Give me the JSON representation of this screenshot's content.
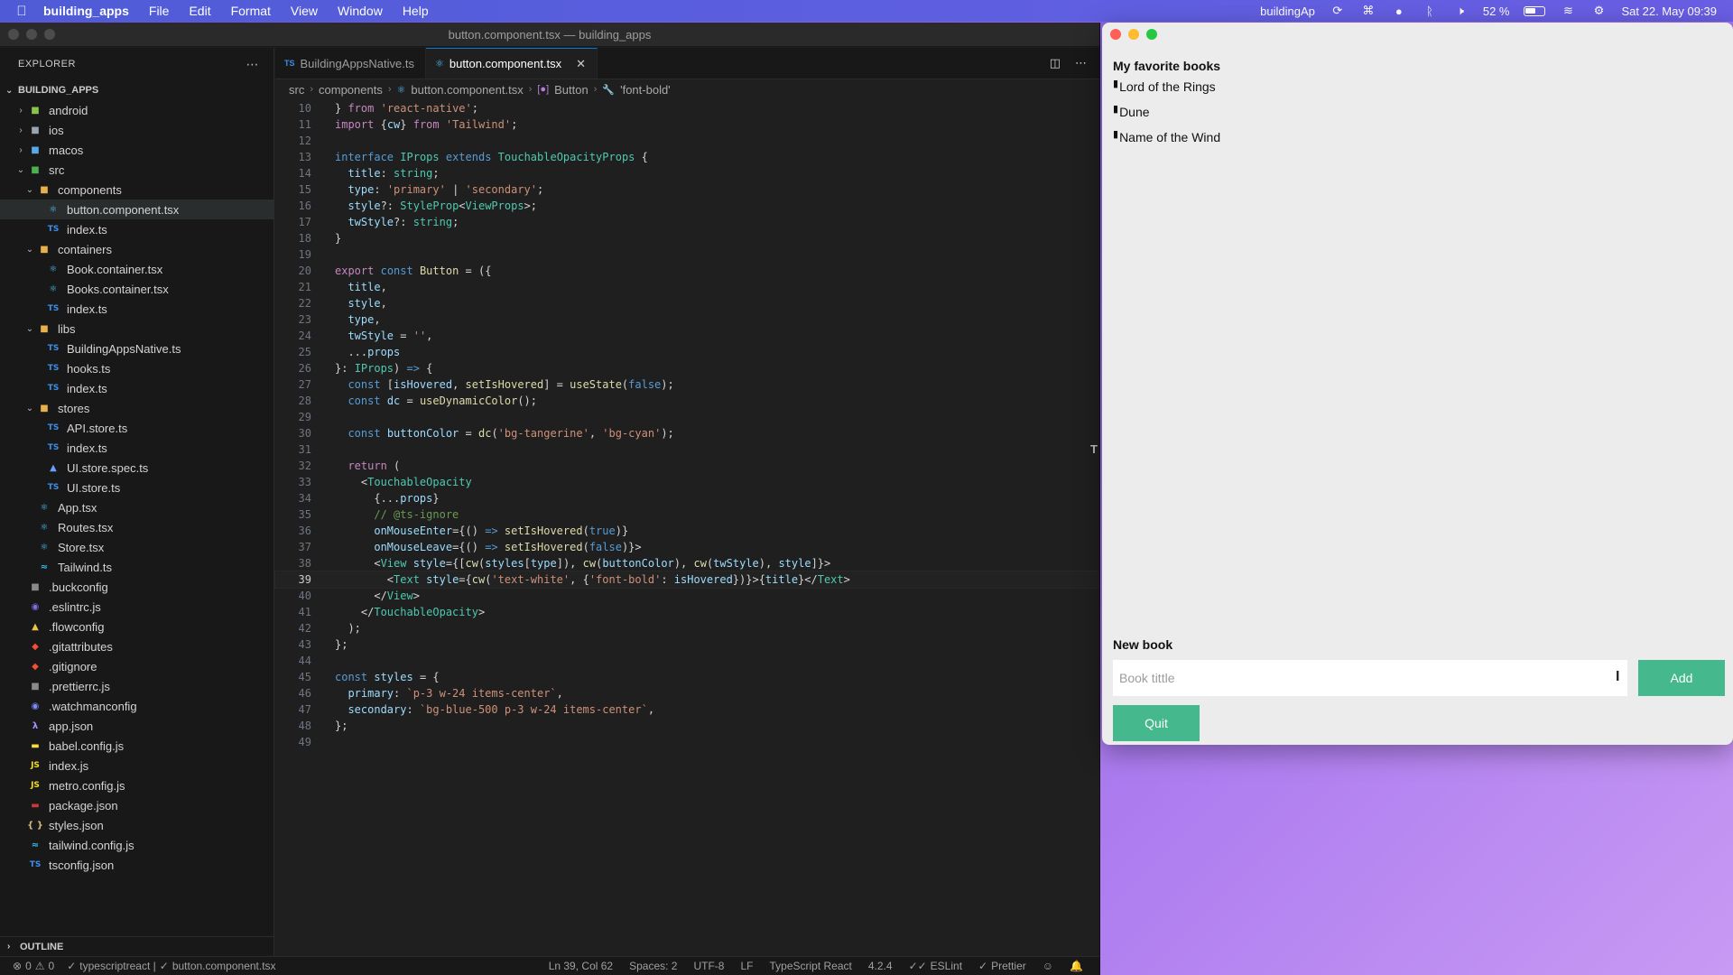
{
  "menubar": {
    "apple_icon": "apple-icon",
    "app_name": "building_apps",
    "menus": [
      "File",
      "Edit",
      "Format",
      "View",
      "Window",
      "Help"
    ],
    "tray_app": "buildingAp",
    "battery_percent": "52 %",
    "battery_level": 0.52,
    "datetime": "Sat 22. May  09:39"
  },
  "vscode": {
    "window_title": "button.component.tsx — building_apps",
    "explorer_label": "EXPLORER",
    "root_label": "BUILDING_APPS",
    "tree": [
      {
        "label": "android",
        "indent": 1,
        "chev": "›",
        "icon": "folder-android"
      },
      {
        "label": "ios",
        "indent": 1,
        "chev": "›",
        "icon": "folder-ios"
      },
      {
        "label": "macos",
        "indent": 1,
        "chev": "›",
        "icon": "folder-macos"
      },
      {
        "label": "src",
        "indent": 1,
        "chev": "⌄",
        "icon": "folder-src"
      },
      {
        "label": "components",
        "indent": 2,
        "chev": "⌄",
        "icon": "folder"
      },
      {
        "label": "button.component.tsx",
        "indent": 3,
        "chev": "",
        "icon": "react",
        "selected": true
      },
      {
        "label": "index.ts",
        "indent": 3,
        "chev": "",
        "icon": "ts"
      },
      {
        "label": "containers",
        "indent": 2,
        "chev": "⌄",
        "icon": "folder"
      },
      {
        "label": "Book.container.tsx",
        "indent": 3,
        "chev": "",
        "icon": "react"
      },
      {
        "label": "Books.container.tsx",
        "indent": 3,
        "chev": "",
        "icon": "react"
      },
      {
        "label": "index.ts",
        "indent": 3,
        "chev": "",
        "icon": "ts"
      },
      {
        "label": "libs",
        "indent": 2,
        "chev": "⌄",
        "icon": "folder"
      },
      {
        "label": "BuildingAppsNative.ts",
        "indent": 3,
        "chev": "",
        "icon": "ts"
      },
      {
        "label": "hooks.ts",
        "indent": 3,
        "chev": "",
        "icon": "ts"
      },
      {
        "label": "index.ts",
        "indent": 3,
        "chev": "",
        "icon": "ts"
      },
      {
        "label": "stores",
        "indent": 2,
        "chev": "⌄",
        "icon": "folder"
      },
      {
        "label": "API.store.ts",
        "indent": 3,
        "chev": "",
        "icon": "ts"
      },
      {
        "label": "index.ts",
        "indent": 3,
        "chev": "",
        "icon": "ts"
      },
      {
        "label": "UI.store.spec.ts",
        "indent": 3,
        "chev": "",
        "icon": "test"
      },
      {
        "label": "UI.store.ts",
        "indent": 3,
        "chev": "",
        "icon": "ts"
      },
      {
        "label": "App.tsx",
        "indent": 2,
        "chev": "",
        "icon": "react"
      },
      {
        "label": "Routes.tsx",
        "indent": 2,
        "chev": "",
        "icon": "react"
      },
      {
        "label": "Store.tsx",
        "indent": 2,
        "chev": "",
        "icon": "react"
      },
      {
        "label": "Tailwind.ts",
        "indent": 2,
        "chev": "",
        "icon": "tw"
      },
      {
        "label": ".buckconfig",
        "indent": 1,
        "chev": "",
        "icon": "misc"
      },
      {
        "label": ".eslintrc.js",
        "indent": 1,
        "chev": "",
        "icon": "eslint"
      },
      {
        "label": ".flowconfig",
        "indent": 1,
        "chev": "",
        "icon": "flow"
      },
      {
        "label": ".gitattributes",
        "indent": 1,
        "chev": "",
        "icon": "git"
      },
      {
        "label": ".gitignore",
        "indent": 1,
        "chev": "",
        "icon": "git"
      },
      {
        "label": ".prettierrc.js",
        "indent": 1,
        "chev": "",
        "icon": "misc"
      },
      {
        "label": ".watchmanconfig",
        "indent": 1,
        "chev": "",
        "icon": "watch"
      },
      {
        "label": "app.json",
        "indent": 1,
        "chev": "",
        "icon": "app"
      },
      {
        "label": "babel.config.js",
        "indent": 1,
        "chev": "",
        "icon": "babel"
      },
      {
        "label": "index.js",
        "indent": 1,
        "chev": "",
        "icon": "js"
      },
      {
        "label": "metro.config.js",
        "indent": 1,
        "chev": "",
        "icon": "js"
      },
      {
        "label": "package.json",
        "indent": 1,
        "chev": "",
        "icon": "npm"
      },
      {
        "label": "styles.json",
        "indent": 1,
        "chev": "",
        "icon": "json"
      },
      {
        "label": "tailwind.config.js",
        "indent": 1,
        "chev": "",
        "icon": "tw"
      },
      {
        "label": "tsconfig.json",
        "indent": 1,
        "chev": "",
        "icon": "ts"
      }
    ],
    "outline_label": "OUTLINE",
    "tabs": [
      {
        "label": "BuildingAppsNative.ts",
        "active": false
      },
      {
        "label": "button.component.tsx",
        "active": true
      }
    ],
    "breadcrumb": [
      "src",
      "components",
      "button.component.tsx",
      "Button",
      "'font-bold'"
    ],
    "current_line": 39,
    "code": [
      {
        "n": "10",
        "html": "} <span class='kw2'>from</span> <span class='str'>'react-native'</span>;"
      },
      {
        "n": "11",
        "html": "<span class='kw2'>import</span> {<span class='var'>cw</span>} <span class='kw2'>from</span> <span class='str'>'Tailwind'</span>;"
      },
      {
        "n": "12",
        "html": ""
      },
      {
        "n": "13",
        "html": "<span class='kw'>interface</span> <span class='typ'>IProps</span> <span class='kw'>extends</span> <span class='typ'>TouchableOpacityProps</span> {"
      },
      {
        "n": "14",
        "html": "  <span class='var'>title</span>: <span class='typ'>string</span>;"
      },
      {
        "n": "15",
        "html": "  <span class='var'>type</span>: <span class='str'>'primary'</span> | <span class='str'>'secondary'</span>;"
      },
      {
        "n": "16",
        "html": "  <span class='var'>style</span>?: <span class='typ'>StyleProp</span>&lt;<span class='typ'>ViewProps</span>&gt;;"
      },
      {
        "n": "17",
        "html": "  <span class='var'>twStyle</span>?: <span class='typ'>string</span>;"
      },
      {
        "n": "18",
        "html": "}"
      },
      {
        "n": "19",
        "html": ""
      },
      {
        "n": "20",
        "html": "<span class='kw2'>export</span> <span class='kw'>const</span> <span class='fn'>Button</span> = ({"
      },
      {
        "n": "21",
        "html": "  <span class='var'>title</span>,"
      },
      {
        "n": "22",
        "html": "  <span class='var'>style</span>,"
      },
      {
        "n": "23",
        "html": "  <span class='var'>type</span>,"
      },
      {
        "n": "24",
        "html": "  <span class='var'>twStyle</span> = <span class='str'>''</span>,"
      },
      {
        "n": "25",
        "html": "  ...<span class='var'>props</span>"
      },
      {
        "n": "26",
        "html": "}: <span class='typ'>IProps</span>) <span class='kw'>=&gt;</span> {"
      },
      {
        "n": "27",
        "html": "  <span class='kw'>const</span> [<span class='var'>isHovered</span>, <span class='fn'>setIsHovered</span>] = <span class='fn'>useState</span>(<span class='kw'>false</span>);"
      },
      {
        "n": "28",
        "html": "  <span class='kw'>const</span> <span class='var'>dc</span> = <span class='fn'>useDynamicColor</span>();"
      },
      {
        "n": "29",
        "html": ""
      },
      {
        "n": "30",
        "html": "  <span class='kw'>const</span> <span class='var'>buttonColor</span> = <span class='fn'>dc</span>(<span class='str'>'bg-tangerine'</span>, <span class='str'>'bg-cyan'</span>);"
      },
      {
        "n": "31",
        "html": ""
      },
      {
        "n": "32",
        "html": "  <span class='kw2'>return</span> ("
      },
      {
        "n": "33",
        "html": "    &lt;<span class='tag'>TouchableOpacity</span>"
      },
      {
        "n": "34",
        "html": "      {...<span class='var'>props</span>}"
      },
      {
        "n": "35",
        "html": "      <span class='com'>// @ts-ignore</span>"
      },
      {
        "n": "36",
        "html": "      <span class='var'>onMouseEnter</span>={() <span class='kw'>=&gt;</span> <span class='fn'>setIsHovered</span>(<span class='kw'>true</span>)}"
      },
      {
        "n": "37",
        "html": "      <span class='var'>onMouseLeave</span>={() <span class='kw'>=&gt;</span> <span class='fn'>setIsHovered</span>(<span class='kw'>false</span>)}&gt;"
      },
      {
        "n": "38",
        "html": "      &lt;<span class='tag'>View</span> <span class='var'>style</span>={[<span class='fn'>cw</span>(<span class='var'>styles</span>[<span class='var'>type</span>]), <span class='fn'>cw</span>(<span class='var'>buttonColor</span>), <span class='fn'>cw</span>(<span class='var'>twStyle</span>), <span class='var'>style</span>]}&gt;"
      },
      {
        "n": "39",
        "html": "        &lt;<span class='tag'>Text</span> <span class='var'>style</span>={<span class='fn'>cw</span>(<span class='str'>'text-white'</span>, {<span class='str'>'font-bold'</span>: <span class='var'>isHovered</span>})}&gt;{<span class='var'>title</span>}&lt;/<span class='tag'>Text</span>&gt;"
      },
      {
        "n": "40",
        "html": "      &lt;/<span class='tag'>View</span>&gt;"
      },
      {
        "n": "41",
        "html": "    &lt;/<span class='tag'>TouchableOpacity</span>&gt;"
      },
      {
        "n": "42",
        "html": "  );"
      },
      {
        "n": "43",
        "html": "};"
      },
      {
        "n": "44",
        "html": ""
      },
      {
        "n": "45",
        "html": "<span class='kw'>const</span> <span class='var'>styles</span> = {"
      },
      {
        "n": "46",
        "html": "  <span class='var'>primary</span>: <span class='str'>`p-3 w-24 items-center`</span>,"
      },
      {
        "n": "47",
        "html": "  <span class='var'>secondary</span>: <span class='str'>`bg-blue-500 p-3 w-24 items-center`</span>,"
      },
      {
        "n": "48",
        "html": "};"
      },
      {
        "n": "49",
        "html": ""
      }
    ],
    "status": {
      "errors": "0",
      "warnings": "0",
      "language_check": "typescriptreact | ",
      "file_check": "button.component.tsx",
      "position": "Ln 39, Col 62",
      "spaces": "Spaces: 2",
      "encoding": "UTF-8",
      "eol": "LF",
      "language": "TypeScript React",
      "ts_version": "4.2.4",
      "eslint": "ESLint",
      "prettier": "Prettier"
    }
  },
  "app": {
    "favorites_title": "My favorite books",
    "books": [
      "Lord of the Rings",
      "Dune",
      "Name of the Wind"
    ],
    "new_book_title": "New book",
    "input_placeholder": "Book tittle",
    "add_label": "Add",
    "quit_label": "Quit",
    "accent_color": "#45b88d"
  }
}
